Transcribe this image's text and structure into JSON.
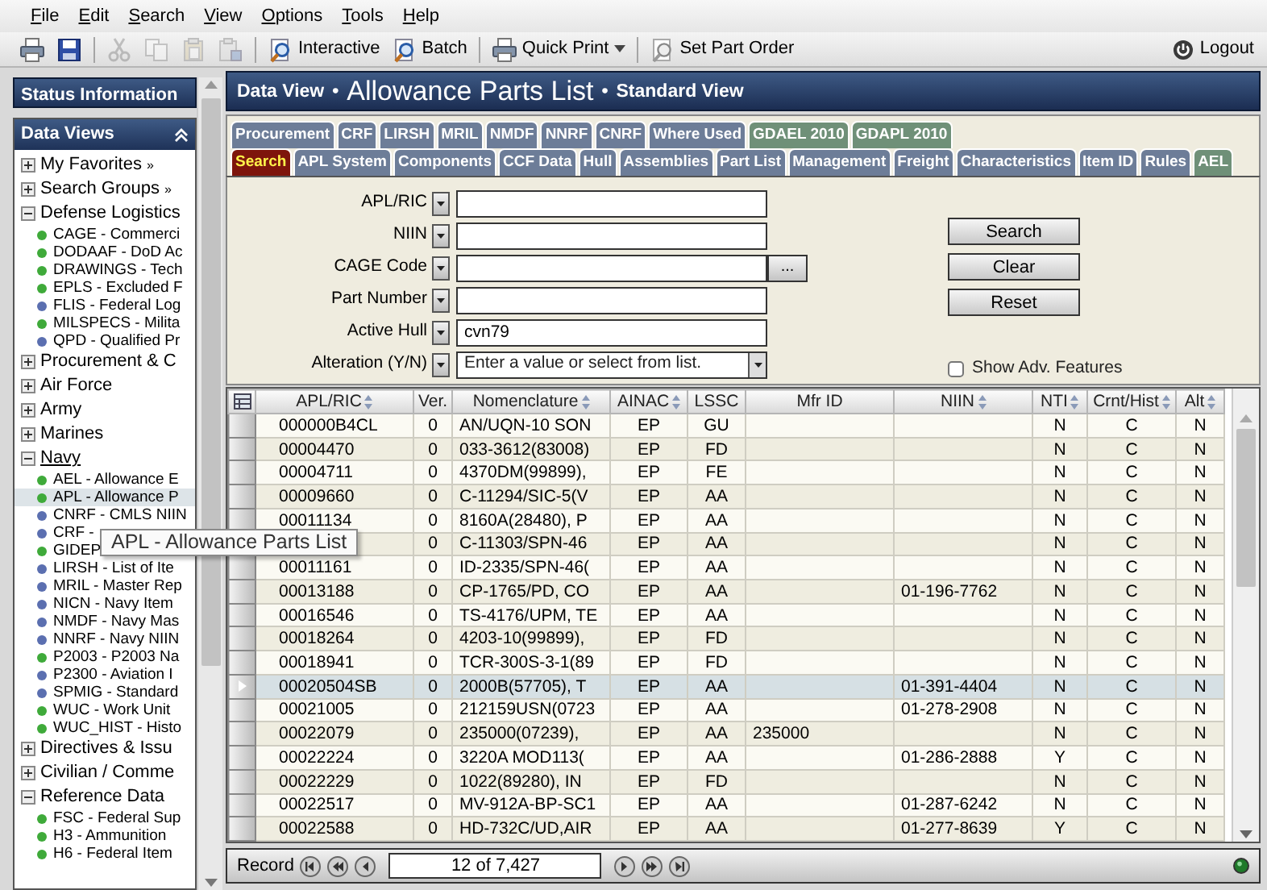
{
  "menu": [
    "File",
    "Edit",
    "Search",
    "View",
    "Options",
    "Tools",
    "Help"
  ],
  "toolbar": [
    {
      "kind": "icon",
      "disabled": false
    },
    {
      "kind": "icon",
      "disabled": false
    },
    {
      "kind": "sep"
    },
    {
      "kind": "icon",
      "disabled": true
    },
    {
      "kind": "icon",
      "disabled": true
    },
    {
      "kind": "icon",
      "disabled": true
    },
    {
      "kind": "icon",
      "disabled": true
    },
    {
      "kind": "sep"
    },
    {
      "kind": "button",
      "label": "Interactive",
      "disabled": false,
      "dropdown": false
    },
    {
      "kind": "button",
      "label": "Batch",
      "disabled": false,
      "dropdown": false
    },
    {
      "kind": "sep"
    },
    {
      "kind": "button",
      "label": "Quick Print",
      "disabled": false,
      "dropdown": true
    },
    {
      "kind": "sep"
    },
    {
      "kind": "button",
      "label": "Set Part Order",
      "disabled": false,
      "dropdown": false
    }
  ],
  "logout": "Logout",
  "sidebar": {
    "status_title": "Status Information",
    "views_title": "Data Views",
    "tree": [
      {
        "label": "My Favorites",
        "suffix": "»",
        "expanded": false,
        "hovered": false
      },
      {
        "label": "Search Groups",
        "suffix": "»",
        "expanded": false,
        "hovered": false
      },
      {
        "label": "Defense Logistics",
        "expanded": true,
        "hovered": false,
        "children": [
          {
            "label": "CAGE - Commerci",
            "color": "#3faa3a",
            "selected": false
          },
          {
            "label": "DODAAF - DoD Ac",
            "color": "#3faa3a",
            "selected": false
          },
          {
            "label": "DRAWINGS - Tech",
            "color": "#3faa3a",
            "selected": false
          },
          {
            "label": "EPLS - Excluded F",
            "color": "#3faa3a",
            "selected": false
          },
          {
            "label": "FLIS - Federal Log",
            "color": "#5b6fb0",
            "selected": false
          },
          {
            "label": "MILSPECS - Milita",
            "color": "#3faa3a",
            "selected": false
          },
          {
            "label": "QPD - Qualified Pr",
            "color": "#5b6fb0",
            "selected": false
          }
        ]
      },
      {
        "label": "Procurement & C",
        "expanded": false,
        "hovered": false
      },
      {
        "label": "Air Force",
        "expanded": false,
        "hovered": false
      },
      {
        "label": "Army",
        "expanded": false,
        "hovered": false
      },
      {
        "label": "Marines",
        "expanded": false,
        "hovered": false
      },
      {
        "label": "Navy",
        "expanded": true,
        "hovered": true,
        "children": [
          {
            "label": "AEL - Allowance E",
            "color": "#3faa3a",
            "selected": false
          },
          {
            "label": "APL - Allowance P",
            "color": "#3faa3a",
            "selected": true
          },
          {
            "label": "CNRF - CMLS NIIN",
            "color": "#5b6fb0",
            "selected": false
          },
          {
            "label": "CRF -",
            "color": "#5b6fb0",
            "selected": false
          },
          {
            "label": "GIDEP",
            "color": "#3faa3a",
            "selected": false
          },
          {
            "label": "LIRSH - List of Ite",
            "color": "#5b6fb0",
            "selected": false
          },
          {
            "label": "MRIL - Master Rep",
            "color": "#5b6fb0",
            "selected": false
          },
          {
            "label": "NICN - Navy Item",
            "color": "#5b6fb0",
            "selected": false
          },
          {
            "label": "NMDF - Navy Mas",
            "color": "#5b6fb0",
            "selected": false
          },
          {
            "label": "NNRF - Navy NIIN",
            "color": "#5b6fb0",
            "selected": false
          },
          {
            "label": "P2003 - P2003 Na",
            "color": "#3faa3a",
            "selected": false
          },
          {
            "label": "P2300 - Aviation I",
            "color": "#5b6fb0",
            "selected": false
          },
          {
            "label": "SPMIG - Standard",
            "color": "#5b6fb0",
            "selected": false
          },
          {
            "label": "WUC - Work Unit",
            "color": "#3faa3a",
            "selected": false
          },
          {
            "label": "WUC_HIST - Histo",
            "color": "#3faa3a",
            "selected": false
          }
        ]
      },
      {
        "label": "Directives & Issu",
        "expanded": false,
        "hovered": false
      },
      {
        "label": "Civilian / Comme",
        "expanded": false,
        "hovered": false
      },
      {
        "label": "Reference Data",
        "expanded": true,
        "hovered": false,
        "children": [
          {
            "label": "FSC - Federal Sup",
            "color": "#3faa3a",
            "selected": false
          },
          {
            "label": "H3 - Ammunition",
            "color": "#3faa3a",
            "selected": false
          },
          {
            "label": "H6 - Federal Item",
            "color": "#3faa3a",
            "selected": false
          }
        ]
      }
    ],
    "tooltip": "APL - Allowance Parts List"
  },
  "view_header": [
    {
      "text": "Data View",
      "kind": "small"
    },
    {
      "text": "•",
      "kind": "sep"
    },
    {
      "text": "Allowance Parts List",
      "kind": "large"
    },
    {
      "text": "•",
      "kind": "sep"
    },
    {
      "text": "Standard View",
      "kind": "small"
    }
  ],
  "tabs": [
    [
      {
        "label": "Procurement",
        "selected": false,
        "color": "#6d7d98"
      },
      {
        "label": "CRF",
        "selected": false,
        "color": "#6d7d98"
      },
      {
        "label": "LIRSH",
        "selected": false,
        "color": "#6d7d98"
      },
      {
        "label": "MRIL",
        "selected": false,
        "color": "#6d7d98"
      },
      {
        "label": "NMDF",
        "selected": false,
        "color": "#6d7d98"
      },
      {
        "label": "NNRF",
        "selected": false,
        "color": "#6d7d98"
      },
      {
        "label": "CNRF",
        "selected": false,
        "color": "#6d7d98"
      },
      {
        "label": "Where Used",
        "selected": false,
        "color": "#6d7d98"
      },
      {
        "label": "GDAEL 2010",
        "selected": false,
        "color": "#6f9078"
      },
      {
        "label": "GDAPL 2010",
        "selected": false,
        "color": "#6f9078"
      }
    ],
    [
      {
        "label": "Search",
        "selected": true
      },
      {
        "label": "APL System",
        "selected": false,
        "color": "#6d7d98"
      },
      {
        "label": "Components",
        "selected": false,
        "color": "#6d7d98"
      },
      {
        "label": "CCF Data",
        "selected": false,
        "color": "#6d7d98"
      },
      {
        "label": "Hull",
        "selected": false,
        "color": "#6d7d98"
      },
      {
        "label": "Assemblies",
        "selected": false,
        "color": "#6d7d98"
      },
      {
        "label": "Part List",
        "selected": false,
        "color": "#6d7d98"
      },
      {
        "label": "Management",
        "selected": false,
        "color": "#6d7d98"
      },
      {
        "label": "Freight",
        "selected": false,
        "color": "#6d7d98"
      },
      {
        "label": "Characteristics",
        "selected": false,
        "color": "#6d7d98"
      },
      {
        "label": "Item ID",
        "selected": false,
        "color": "#6d7d98"
      },
      {
        "label": "Rules",
        "selected": false,
        "color": "#6d7d98"
      },
      {
        "label": "AEL",
        "selected": false,
        "color": "#6f9078"
      }
    ]
  ],
  "search_form": {
    "fields": [
      {
        "label": "APL/RIC",
        "kind": "text"
      },
      {
        "label": "NIIN",
        "kind": "text"
      },
      {
        "label": "CAGE Code",
        "kind": "lookup",
        "button": "..."
      },
      {
        "label": "Part Number",
        "kind": "text"
      },
      {
        "label": "Active Hull",
        "kind": "text",
        "value": "cvn79"
      },
      {
        "label": "Alteration (Y/N)",
        "kind": "combo",
        "placeholder": "Enter a value or select from list."
      }
    ],
    "buttons": [
      "Search",
      "Clear",
      "Reset"
    ],
    "option": {
      "label": "Show Adv. Features",
      "checked": false
    }
  },
  "grid": {
    "columns": [
      {
        "label": "APL/RIC",
        "sortable": true
      },
      {
        "label": "Ver.",
        "sortable": false
      },
      {
        "label": "Nomenclature",
        "sortable": true
      },
      {
        "label": "AINAC",
        "sortable": true
      },
      {
        "label": "LSSC",
        "sortable": false
      },
      {
        "label": "Mfr ID",
        "sortable": false
      },
      {
        "label": "NIIN",
        "sortable": true
      },
      {
        "label": "NTI",
        "sortable": true
      },
      {
        "label": "Crnt/Hist",
        "sortable": true
      },
      {
        "label": "Alt",
        "sortable": true
      }
    ],
    "rows": [
      {
        "selected": false,
        "cells": [
          "000000B4CL",
          "0",
          "AN/UQN-10 SON",
          "EP",
          "GU",
          null,
          null,
          "N",
          "C",
          "N"
        ]
      },
      {
        "selected": false,
        "cells": [
          "00004470",
          "0",
          "033-3612(83008)",
          "EP",
          "FD",
          null,
          null,
          "N",
          "C",
          "N"
        ]
      },
      {
        "selected": false,
        "cells": [
          "00004711",
          "0",
          "4370DM(99899),",
          "EP",
          "FE",
          null,
          null,
          "N",
          "C",
          "N"
        ]
      },
      {
        "selected": false,
        "cells": [
          "00009660",
          "0",
          "C-11294/SIC-5(V",
          "EP",
          "AA",
          null,
          null,
          "N",
          "C",
          "N"
        ]
      },
      {
        "selected": false,
        "cells": [
          "00011134",
          "0",
          "8160A(28480), P",
          "EP",
          "AA",
          null,
          null,
          "N",
          "C",
          "N"
        ]
      },
      {
        "selected": false,
        "cells": [
          null,
          "0",
          "C-11303/SPN-46",
          "EP",
          "AA",
          null,
          null,
          "N",
          "C",
          "N"
        ]
      },
      {
        "selected": false,
        "cells": [
          "00011161",
          "0",
          "ID-2335/SPN-46(",
          "EP",
          "AA",
          null,
          null,
          "N",
          "C",
          "N"
        ]
      },
      {
        "selected": false,
        "cells": [
          "00013188",
          "0",
          "CP-1765/PD, CO",
          "EP",
          "AA",
          null,
          "01-196-7762",
          "N",
          "C",
          "N"
        ]
      },
      {
        "selected": false,
        "cells": [
          "00016546",
          "0",
          "TS-4176/UPM, TE",
          "EP",
          "AA",
          null,
          null,
          "N",
          "C",
          "N"
        ]
      },
      {
        "selected": false,
        "cells": [
          "00018264",
          "0",
          "4203-10(99899),",
          "EP",
          "FD",
          null,
          null,
          "N",
          "C",
          "N"
        ]
      },
      {
        "selected": false,
        "cells": [
          "00018941",
          "0",
          "TCR-300S-3-1(89",
          "EP",
          "FD",
          null,
          null,
          "N",
          "C",
          "N"
        ]
      },
      {
        "selected": true,
        "cells": [
          "00020504SB",
          "0",
          "2000B(57705), T",
          "EP",
          "AA",
          null,
          "01-391-4404",
          "N",
          "C",
          "N"
        ]
      },
      {
        "selected": false,
        "cells": [
          "00021005",
          "0",
          "212159USN(0723",
          "EP",
          "AA",
          null,
          "01-278-2908",
          "N",
          "C",
          "N"
        ]
      },
      {
        "selected": false,
        "cells": [
          "00022079",
          "0",
          "235000(07239),",
          "EP",
          "AA",
          "235000",
          null,
          "N",
          "C",
          "N"
        ]
      },
      {
        "selected": false,
        "cells": [
          "00022224",
          "0",
          "3220A MOD113(",
          "EP",
          "AA",
          null,
          "01-286-2888",
          "Y",
          "C",
          "N"
        ]
      },
      {
        "selected": false,
        "cells": [
          "00022229",
          "0",
          "1022(89280), IN",
          "EP",
          "FD",
          null,
          null,
          "N",
          "C",
          "N"
        ]
      },
      {
        "selected": false,
        "cells": [
          "00022517",
          "0",
          "MV-912A-BP-SC1",
          "EP",
          "AA",
          null,
          "01-287-6242",
          "N",
          "C",
          "N"
        ]
      },
      {
        "selected": false,
        "cells": [
          "00022588",
          "0",
          "HD-732C/UD,AIR",
          "EP",
          "AA",
          null,
          "01-277-8639",
          "Y",
          "C",
          "N"
        ]
      }
    ]
  },
  "record_bar": {
    "label": "Record",
    "position": "12 of 7,427"
  }
}
